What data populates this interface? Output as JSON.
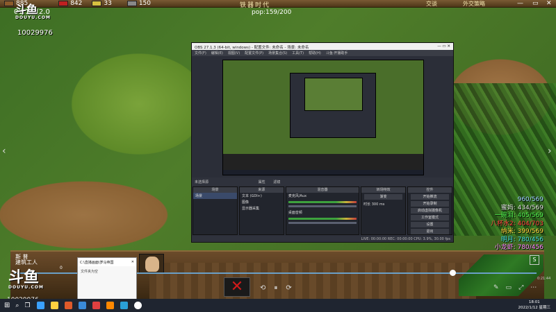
{
  "game": {
    "resources": [
      {
        "value": "885",
        "color": "#8b5a2b"
      },
      {
        "value": "842",
        "color": "#c02020"
      },
      {
        "value": "33",
        "color": "#d8c040"
      },
      {
        "value": "150",
        "color": "#888888"
      }
    ],
    "time": "01:15 (2.0",
    "pop": "pop:159/200",
    "age": "铁器时代",
    "diplomacy": "交谈",
    "civ": "外交策略",
    "scores": [
      {
        "text": "960/569",
        "color": "#9fd0ff"
      },
      {
        "text": "蜜妈: 434/569",
        "color": "#e0e0e0"
      },
      {
        "text": "一碗泪: 405/569",
        "color": "#4ff04f"
      },
      {
        "text": "八杯水2: 404/703",
        "color": "#ff4040"
      },
      {
        "text": "纳米: 399/569",
        "color": "#ffd040"
      },
      {
        "text": "明月: 780/456",
        "color": "#40e0e0"
      },
      {
        "text": "小龙虾: 780/456",
        "color": "#ff80ff"
      }
    ],
    "unit_name": "斯 普",
    "unit_sub": "建筑工人",
    "unit_count": "0"
  },
  "watermark": {
    "logo": "斗鱼",
    "logo_sub": "DOUYU.COM",
    "room_id": "10029976"
  },
  "obs": {
    "title": "OBS 27.1.3 (64-bit, windows) - 配置文件: 未命名 - 场景: 未命名",
    "menu": [
      "文件(F)",
      "编辑(E)",
      "视图(V)",
      "配置文件(P)",
      "场景集合(S)",
      "工具(T)",
      "帮助(H)",
      "斗鱼·开播助手"
    ],
    "source_bar": "未选择源",
    "props_label": "属性",
    "filters_label": "滤镜",
    "docks": {
      "scenes": {
        "header": "场景",
        "items": [
          "场景"
        ]
      },
      "sources": {
        "header": "来源",
        "items": [
          "文本 (GDI+)",
          "图像",
          "显示器采集"
        ]
      },
      "mixer": {
        "header": "混音器",
        "items": [
          "麦克风/Aux",
          "桌面音频"
        ]
      },
      "transitions": {
        "header": "转场特效",
        "type": "渐变",
        "duration_label": "时长",
        "duration": "300 ms"
      },
      "controls": {
        "header": "控件",
        "buttons": [
          "开始推流",
          "开始录制",
          "启动虚拟摄像机",
          "工作室模式",
          "设置",
          "退出"
        ]
      }
    },
    "status": "LIVE: 00:00:00   REC: 00:00:00   CPU: 3.9%, 30.00 fps"
  },
  "player": {
    "video_time": "0:21:44",
    "controls": [
      "⟲",
      "⏸",
      "⟳"
    ]
  },
  "explorer": {
    "title": "C:\\直播画面\\罗马帝国",
    "item": "文件夹为空"
  },
  "taskbar": {
    "time": "18:01",
    "date": "2022/1/12 星期三",
    "icon_colors": [
      "#3aa0ff",
      "#ffd040",
      "#e05a2a",
      "#3a8ad8",
      "#e04040",
      "#ff8800",
      "#2aa0d8",
      "#ffffff"
    ]
  }
}
